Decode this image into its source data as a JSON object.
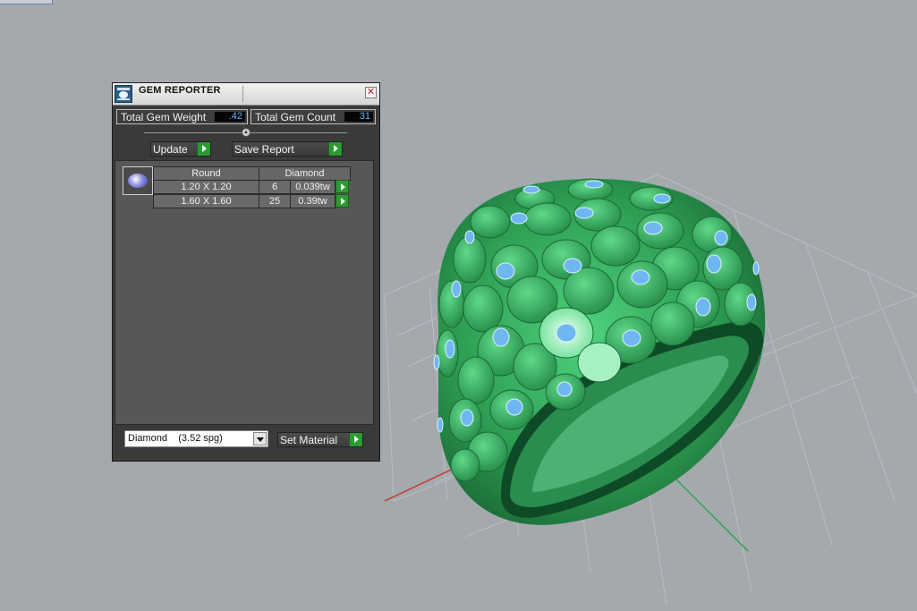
{
  "window": {
    "title": "GEM REPORTER",
    "close_symbol": "✕"
  },
  "summary": {
    "weight_label": "Total Gem Weight",
    "weight_value": ".42",
    "count_label": "Total Gem Count",
    "count_value": "31"
  },
  "actions": {
    "update_label": "Update",
    "save_label": "Save Report",
    "set_material_label": "Set Material"
  },
  "gem_table": {
    "shape": "Round",
    "material": "Diamond",
    "rows": [
      {
        "size": "1.20 X 1.20",
        "count": "6",
        "weight": "0.039tw"
      },
      {
        "size": "1.60 X 1.60",
        "count": "25",
        "weight": "0.39tw"
      }
    ]
  },
  "material_select": {
    "value": "Diamond    (3.52 spg)"
  },
  "colors": {
    "viewport_bg": "#a4a9ae",
    "ring_green": "#2e9e52",
    "gem_blue": "#6fb7f0",
    "axis_x": "#c43a2a",
    "axis_y": "#2aa34a"
  },
  "icons": [
    "gem-reporter-icon",
    "close-icon",
    "slider-thumb-icon",
    "play-arrow-icon",
    "gem-thumbnail",
    "dropdown-caret-icon"
  ]
}
